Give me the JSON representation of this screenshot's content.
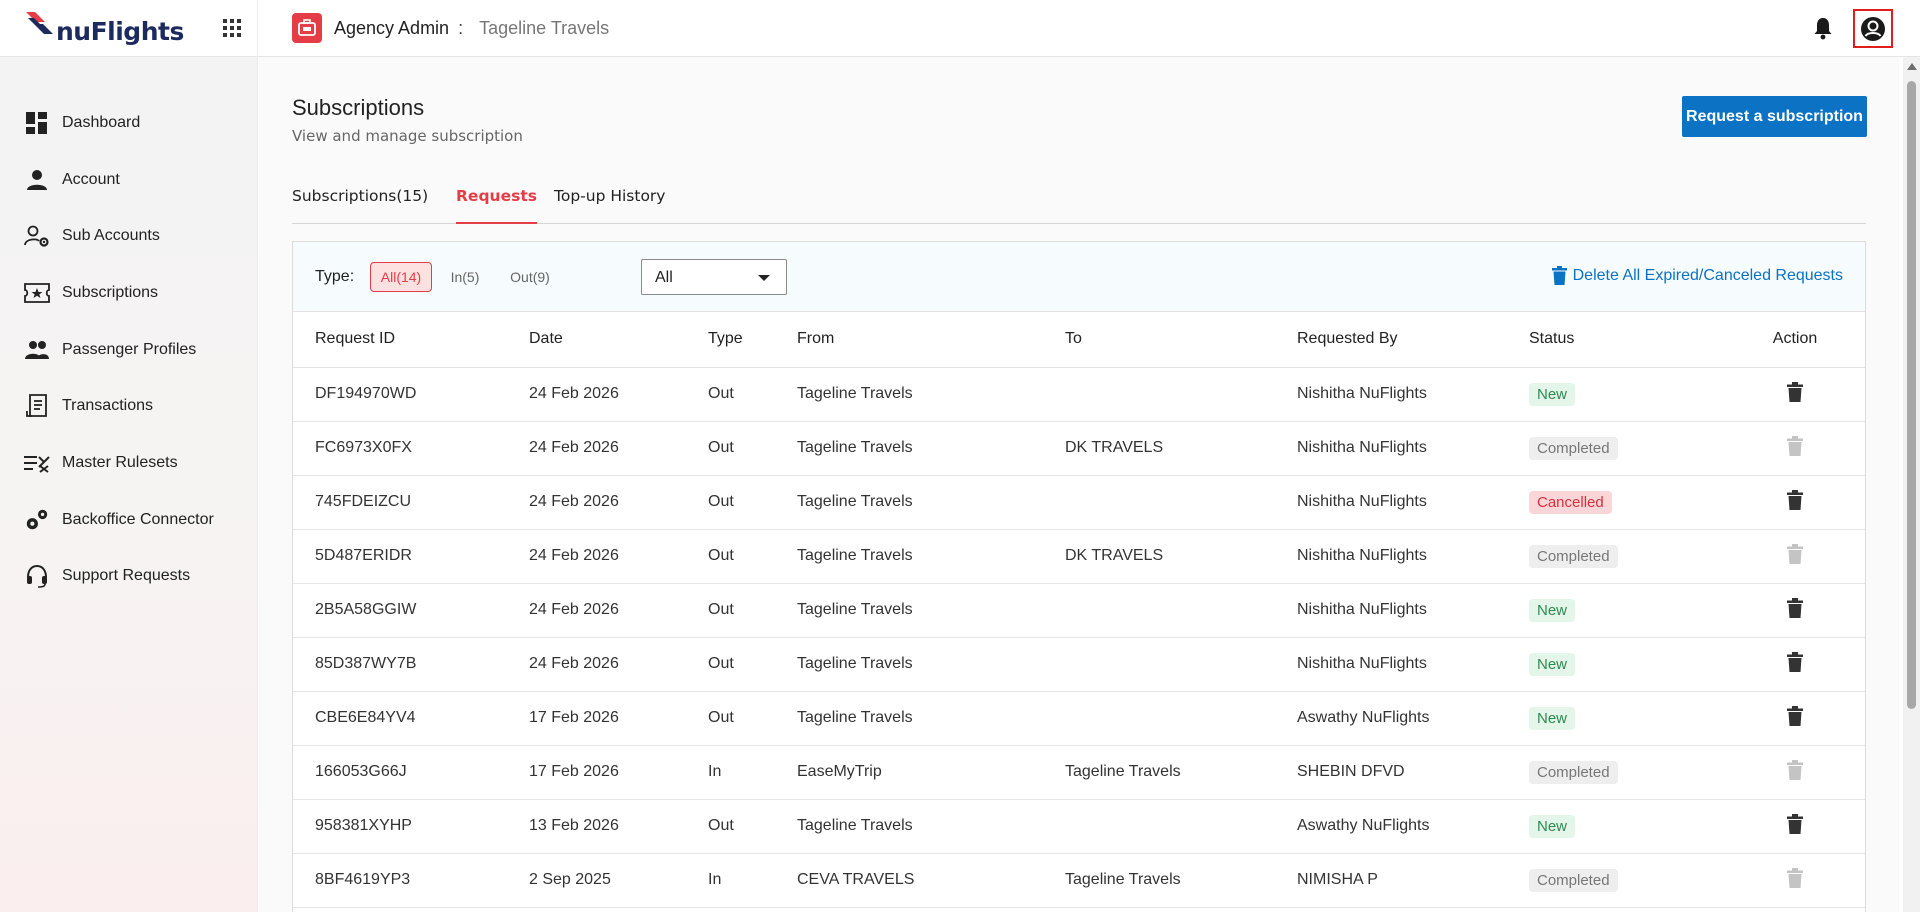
{
  "app": {
    "logo_text": "nuFlights",
    "agency_title": "Agency Admin",
    "agency_separator": ":",
    "agency_name": "Tageline Travels"
  },
  "sidebar": {
    "items": [
      {
        "label": "Dashboard",
        "icon": "dashboard-icon"
      },
      {
        "label": "Account",
        "icon": "person-icon"
      },
      {
        "label": "Sub Accounts",
        "icon": "user-gear-icon"
      },
      {
        "label": "Subscriptions",
        "icon": "ticket-star-icon"
      },
      {
        "label": "Passenger Profiles",
        "icon": "people-icon"
      },
      {
        "label": "Transactions",
        "icon": "receipt-icon"
      },
      {
        "label": "Master Rulesets",
        "icon": "rules-list-icon"
      },
      {
        "label": "Backoffice Connector",
        "icon": "gears-icon"
      },
      {
        "label": "Support Requests",
        "icon": "headset-icon"
      }
    ]
  },
  "page": {
    "title": "Subscriptions",
    "subtitle": "View and manage subscription",
    "request_button": "Request a subscription"
  },
  "tabs": [
    {
      "label": "Subscriptions(15)",
      "active": false
    },
    {
      "label": "Requests",
      "active": true
    },
    {
      "label": "Top-up History",
      "active": false
    }
  ],
  "filters": {
    "type_label": "Type:",
    "chips": [
      {
        "label": "All(14)",
        "active": true
      },
      {
        "label": "In(5)",
        "active": false
      },
      {
        "label": "Out(9)",
        "active": false
      }
    ],
    "select_value": "All",
    "delete_all_label": "Delete All Expired/Canceled Requests"
  },
  "table": {
    "columns": [
      "Request ID",
      "Date",
      "Type",
      "From",
      "To",
      "Requested By",
      "Status",
      "Action"
    ],
    "rows": [
      {
        "id": "DF194970WD",
        "date": "24 Feb 2026",
        "type": "Out",
        "from": "Tageline Travels",
        "to": "",
        "by": "Nishitha NuFlights",
        "status": "New"
      },
      {
        "id": "FC6973X0FX",
        "date": "24 Feb 2026",
        "type": "Out",
        "from": "Tageline Travels",
        "to": "DK TRAVELS",
        "by": "Nishitha NuFlights",
        "status": "Completed"
      },
      {
        "id": "745FDEIZCU",
        "date": "24 Feb 2026",
        "type": "Out",
        "from": "Tageline Travels",
        "to": "",
        "by": "Nishitha NuFlights",
        "status": "Cancelled"
      },
      {
        "id": "5D487ERIDR",
        "date": "24 Feb 2026",
        "type": "Out",
        "from": "Tageline Travels",
        "to": "DK TRAVELS",
        "by": "Nishitha NuFlights",
        "status": "Completed"
      },
      {
        "id": "2B5A58GGIW",
        "date": "24 Feb 2026",
        "type": "Out",
        "from": "Tageline Travels",
        "to": "",
        "by": "Nishitha NuFlights",
        "status": "New"
      },
      {
        "id": "85D387WY7B",
        "date": "24 Feb 2026",
        "type": "Out",
        "from": "Tageline Travels",
        "to": "",
        "by": "Nishitha NuFlights",
        "status": "New"
      },
      {
        "id": "CBE6E84YV4",
        "date": "17 Feb 2026",
        "type": "Out",
        "from": "Tageline Travels",
        "to": "",
        "by": "Aswathy NuFlights",
        "status": "New"
      },
      {
        "id": "166053G66J",
        "date": "17 Feb 2026",
        "type": "In",
        "from": "EaseMyTrip",
        "to": "Tageline Travels",
        "by": "SHEBIN DFVD",
        "status": "Completed"
      },
      {
        "id": "958381XYHP",
        "date": "13 Feb 2026",
        "type": "Out",
        "from": "Tageline Travels",
        "to": "",
        "by": "Aswathy NuFlights",
        "status": "New"
      },
      {
        "id": "8BF4619YP3",
        "date": "2 Sep 2025",
        "type": "In",
        "from": "CEVA TRAVELS",
        "to": "Tageline Travels",
        "by": "NIMISHA P",
        "status": "Completed"
      }
    ]
  },
  "colors": {
    "brand_red": "#e53d46",
    "primary_blue": "#0b72c4",
    "brand_navy": "#1c2a5e"
  }
}
